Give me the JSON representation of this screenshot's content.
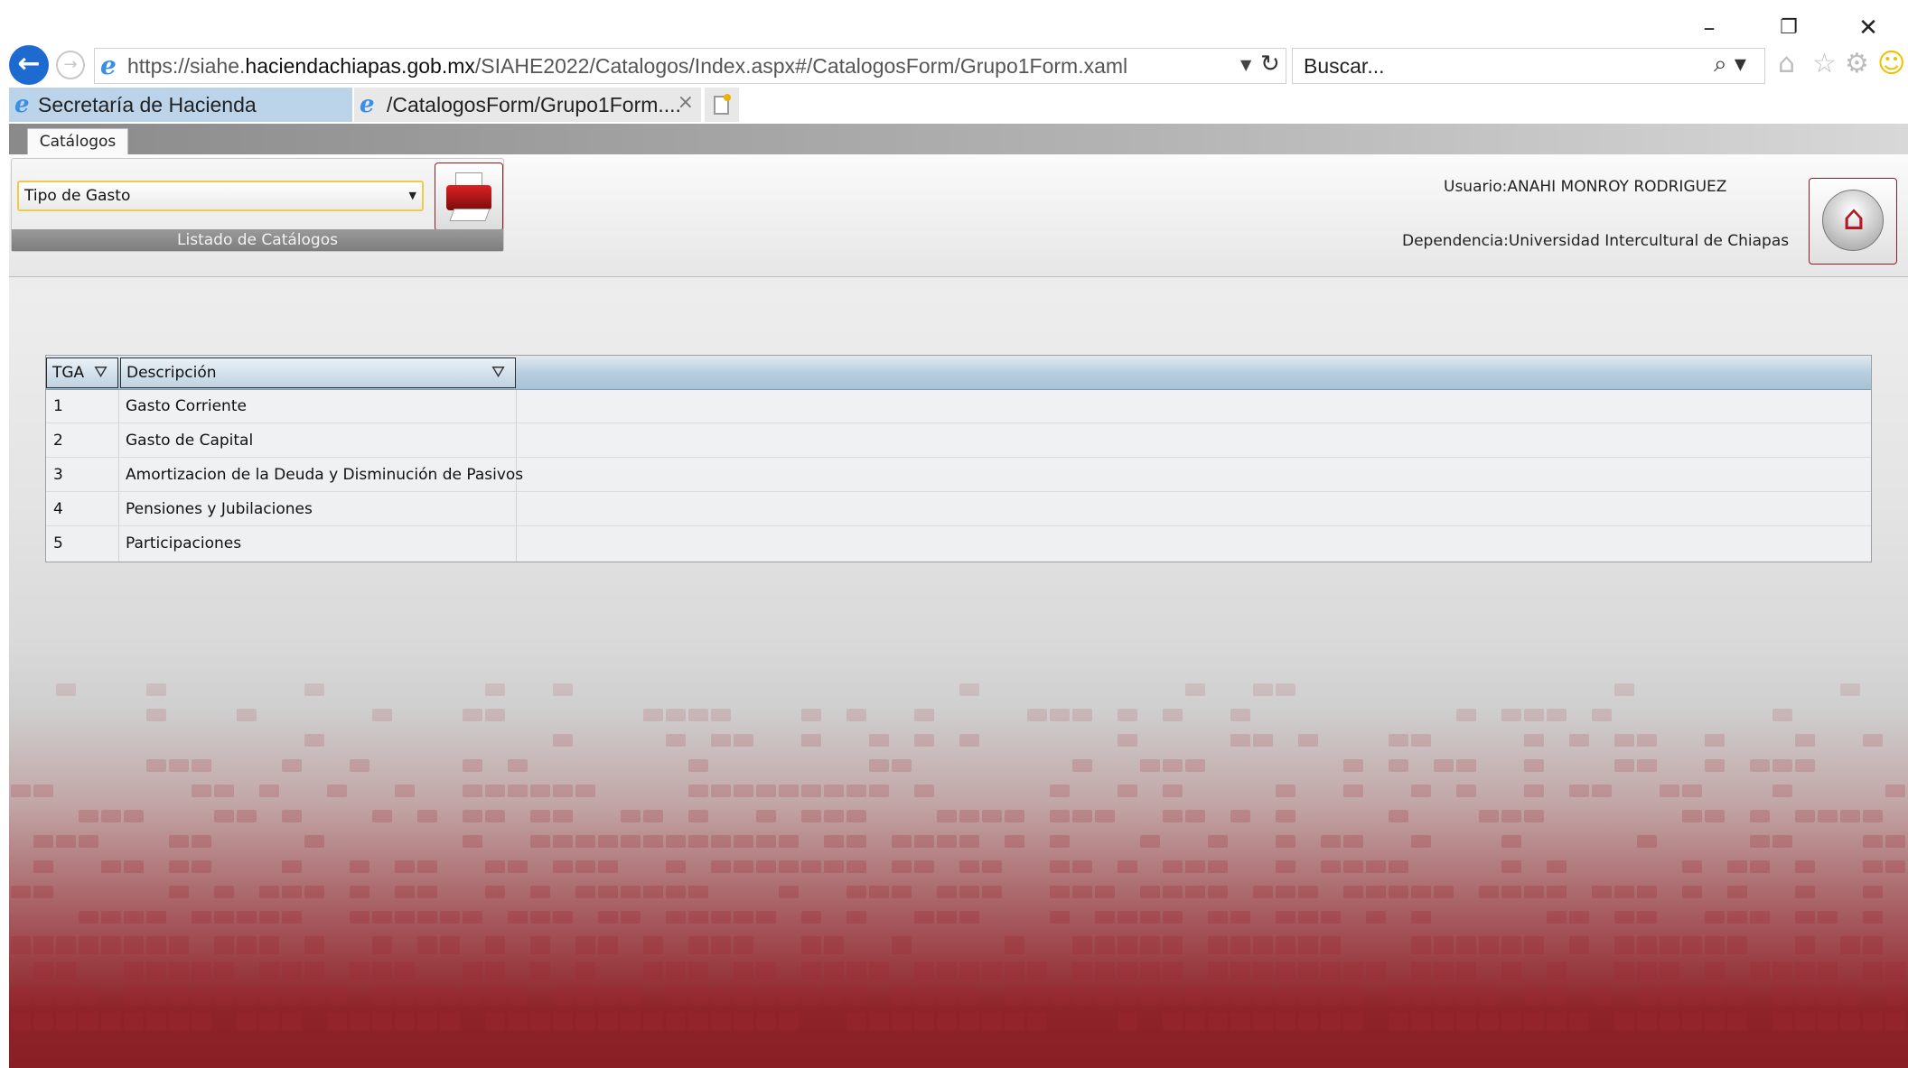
{
  "browser": {
    "url_prefix": "https://siahe.",
    "url_domain": "haciendachiapas.gob.mx",
    "url_path": "/SIAHE2022/Catalogos/Index.aspx#/CatalogosForm/Grupo1Form.xaml",
    "search_placeholder": "Buscar...",
    "tabs": [
      {
        "label": "Secretaría de Hacienda"
      },
      {
        "label": "/CatalogosForm/Grupo1Form...."
      }
    ],
    "tab_close": "×"
  },
  "app": {
    "top_tab": "Catálogos",
    "catalog_select": {
      "value": "Tipo de Gasto"
    },
    "catalog_group_label": "Listado de Catálogos",
    "user_label": "Usuario:",
    "user_value": "ANAHI MONROY RODRIGUEZ",
    "dependency_label": "Dependencia:",
    "dependency_value": "Universidad Intercultural de Chiapas"
  },
  "grid": {
    "columns": [
      {
        "label": "TGA"
      },
      {
        "label": "Descripción"
      }
    ],
    "rows": [
      {
        "tga": "1",
        "descripcion": "Gasto Corriente"
      },
      {
        "tga": "2",
        "descripcion": "Gasto de Capital"
      },
      {
        "tga": "3",
        "descripcion": "Amortizacion de la Deuda y Disminución de Pasivos"
      },
      {
        "tga": "4",
        "descripcion": "Pensiones y Jubilaciones"
      },
      {
        "tga": "5",
        "descripcion": "Participaciones"
      }
    ]
  },
  "icons": {
    "back": "back-arrow-icon",
    "forward": "forward-arrow-icon",
    "refresh": "refresh-icon",
    "search": "search-icon",
    "home": "home-icon",
    "favorites": "star-icon",
    "settings": "gear-icon",
    "feedback": "smiley-icon",
    "filter": "filter-icon",
    "printer": "printer-icon"
  },
  "colors": {
    "accent_red": "#8a1f25",
    "select_border": "#f2c94c",
    "grid_header": "#b9cfdf"
  }
}
